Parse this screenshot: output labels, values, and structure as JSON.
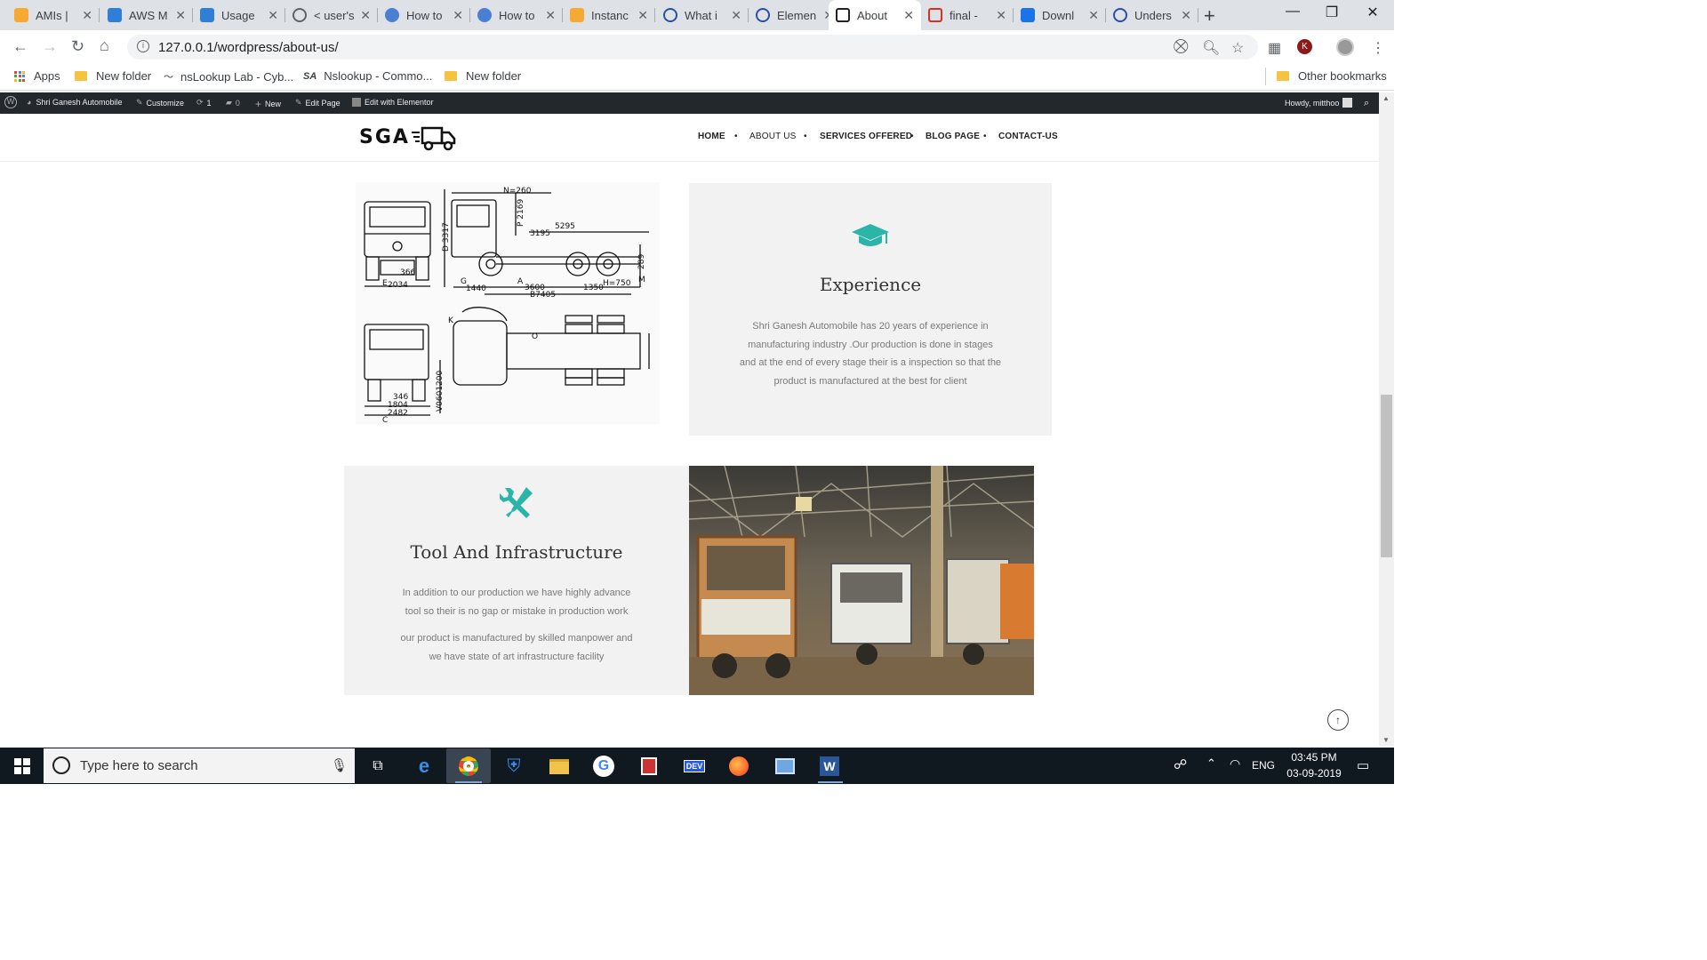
{
  "browser": {
    "tabs": [
      {
        "label": "AMIs |",
        "icon": "aws-box-icon"
      },
      {
        "label": "AWS M",
        "icon": "aws-cube-icon"
      },
      {
        "label": "Usage",
        "icon": "aws-cube-icon"
      },
      {
        "label": "< user's",
        "icon": "globe-icon"
      },
      {
        "label": "How to",
        "icon": "people-icon"
      },
      {
        "label": "How to",
        "icon": "people-icon"
      },
      {
        "label": "Instanc",
        "icon": "aws-box-icon"
      },
      {
        "label": "What i",
        "icon": "elementor-icon"
      },
      {
        "label": "Elemen",
        "icon": "elementor-icon"
      },
      {
        "label": "About",
        "icon": "truck-icon",
        "active": true
      },
      {
        "label": "final -",
        "icon": "gmail-icon"
      },
      {
        "label": "Downl",
        "icon": "download-icon"
      },
      {
        "label": "Unders",
        "icon": "elementor-icon"
      }
    ],
    "url": "127.0.0.1/wordpress/about-us/",
    "profile_initial": "K",
    "bookmarks": [
      {
        "label": "Apps"
      },
      {
        "label": "New folder"
      },
      {
        "label": "nsLookup Lab - Cyb..."
      },
      {
        "label": "Nslookup - Commo..."
      },
      {
        "label": "New folder"
      }
    ],
    "bookmark_sa": "SA",
    "other_bookmarks": "Other bookmarks"
  },
  "wpbar": {
    "site": "Shri Ganesh Automobile",
    "customize": "Customize",
    "updates": "1",
    "comments": "0",
    "new": "New",
    "edit_page": "Edit Page",
    "edit_elementor": "Edit with Elementor",
    "howdy": "Howdy, mitthoo"
  },
  "site": {
    "logo": "SGA",
    "nav": [
      "HOME",
      "ABOUT US",
      "SERVICES OFFERED",
      "BLOG PAGE",
      "CONTACT-US"
    ],
    "accent": "#2bb5a8"
  },
  "drawing_labels": {
    "n": "N=260",
    "p": "P 2169",
    "d": "D 3317",
    "d5295": "5295",
    "d3195": "3195",
    "d366": "366",
    "d2034": "2034",
    "g": "G",
    "d1440": "1440",
    "a": "A",
    "d3600": "3600",
    "b": "B7405",
    "d1350": "1350",
    "h": "H=750",
    "m": "M",
    "d289": "289",
    "k": "K",
    "o": "O",
    "code": "V0601200",
    "d346": "346",
    "d1804": "1804",
    "d2482": "2482",
    "c": "C",
    "e": "E"
  },
  "experience": {
    "title": "Experience",
    "lines": [
      "Shri Ganesh Automobile has 20 years of experience in",
      "manufacturing industry .Our production is done in stages",
      "and at the end of every stage their is a inspection so that the",
      "product is manufactured at the best for client"
    ]
  },
  "tools": {
    "title": "Tool And Infrastructure",
    "p1": [
      "In addition to our production we have highly advance",
      "tool so their is no gap or mistake in production work"
    ],
    "p2": [
      "our product is manufactured by skilled manpower and",
      "we have state of art infrastructure facility"
    ]
  },
  "taskbar": {
    "search_placeholder": "Type here to search",
    "lang": "ENG",
    "time": "03:45 PM",
    "date": "03-09-2019"
  }
}
